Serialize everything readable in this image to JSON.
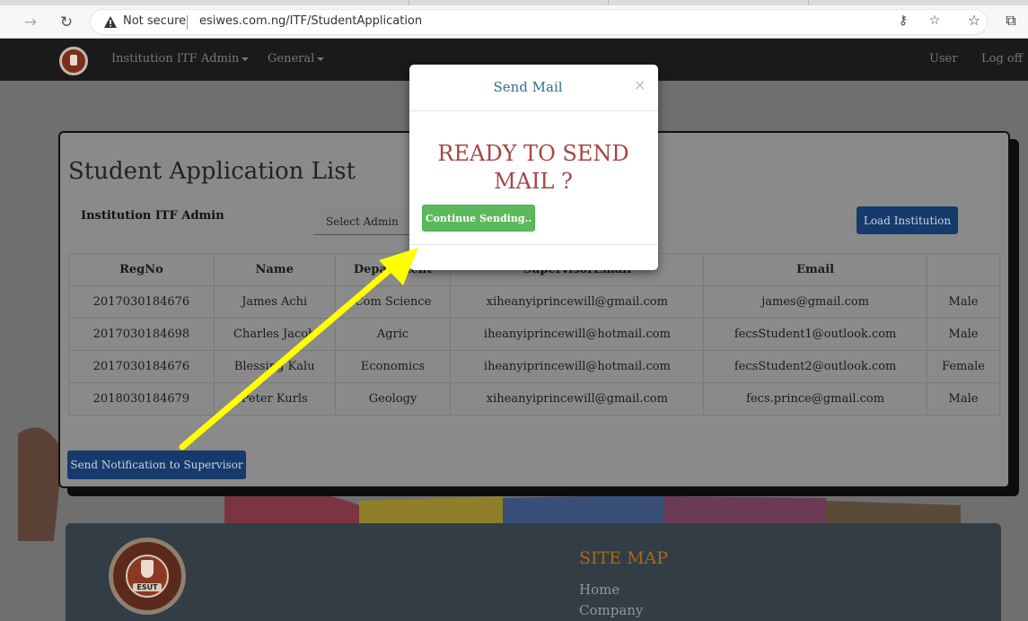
{
  "browser": {
    "back_icon": "arrow-right-icon",
    "reload_icon": "reload-icon",
    "not_secure": "Not secure",
    "url": "esiwes.com.ng/ITF/StudentApplication"
  },
  "navbar": {
    "menu_admin": "Institution ITF Admin",
    "menu_general": "General",
    "user": "User",
    "logoff": "Log off"
  },
  "panel": {
    "title": "Student Application List",
    "admin_label": "Institution ITF Admin",
    "select_value": "Select Admin",
    "load_button": "Load Institution",
    "notify_button": "Send Notification to Supervisor"
  },
  "table": {
    "headers": [
      "RegNo",
      "Name",
      "Department",
      "SupervisorEmail",
      "Email",
      ""
    ],
    "rows": [
      [
        "2017030184676",
        "James Achi",
        "Com Science",
        "xiheanyiprincewill@gmail.com",
        "james@gmail.com",
        "Male"
      ],
      [
        "2017030184698",
        "Charles Jacob",
        "Agric",
        "iheanyiprincewill@hotmail.com",
        "fecsStudent1@outlook.com",
        "Male"
      ],
      [
        "2017030184676",
        "Blessing Kalu",
        "Economics",
        "iheanyiprincewill@hotmail.com",
        "fecsStudent2@outlook.com",
        "Female"
      ],
      [
        "2018030184679",
        "Peter Kurls",
        "Geology",
        "xiheanyiprincewill@gmail.com",
        "fecs.prince@gmail.com",
        "Male"
      ]
    ]
  },
  "footer": {
    "logo_text": "ESUT",
    "sitemap_title": "SITE MAP",
    "links": [
      "Home",
      "Company"
    ]
  },
  "modal": {
    "title": "Send Mail",
    "close": "×",
    "message": "READY TO SEND MAIL ?",
    "continue_button": "Continue Sending.."
  },
  "colors": {
    "modal_title": "#31708f",
    "message": "#a94442",
    "continue": "#5cb85c",
    "annotation_arrow": "#ffff00"
  }
}
